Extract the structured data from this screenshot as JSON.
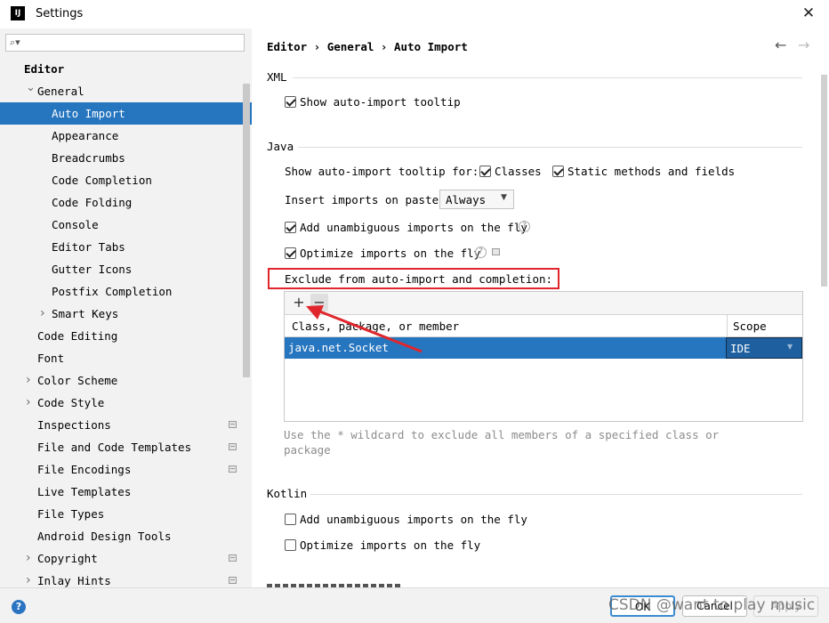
{
  "window": {
    "title": "Settings",
    "logo": "IJ",
    "close_label": "✕"
  },
  "sidebar": {
    "search_icon": "magnifier-icon",
    "items": [
      {
        "label": "Editor",
        "indent": 0,
        "bold": true
      },
      {
        "label": "General",
        "indent": 1,
        "expanded": true
      },
      {
        "label": "Auto Import",
        "indent": 2,
        "selected": true
      },
      {
        "label": "Appearance",
        "indent": 2
      },
      {
        "label": "Breadcrumbs",
        "indent": 2
      },
      {
        "label": "Code Completion",
        "indent": 2
      },
      {
        "label": "Code Folding",
        "indent": 2
      },
      {
        "label": "Console",
        "indent": 2
      },
      {
        "label": "Editor Tabs",
        "indent": 2
      },
      {
        "label": "Gutter Icons",
        "indent": 2
      },
      {
        "label": "Postfix Completion",
        "indent": 2
      },
      {
        "label": "Smart Keys",
        "indent": 2,
        "collapsed": true
      },
      {
        "label": "Code Editing",
        "indent": 1
      },
      {
        "label": "Font",
        "indent": 1
      },
      {
        "label": "Color Scheme",
        "indent": 1,
        "collapsed": true
      },
      {
        "label": "Code Style",
        "indent": 1,
        "collapsed": true
      },
      {
        "label": "Inspections",
        "indent": 1,
        "project": true
      },
      {
        "label": "File and Code Templates",
        "indent": 1,
        "project": true
      },
      {
        "label": "File Encodings",
        "indent": 1,
        "project": true
      },
      {
        "label": "Live Templates",
        "indent": 1
      },
      {
        "label": "File Types",
        "indent": 1
      },
      {
        "label": "Android Design Tools",
        "indent": 1
      },
      {
        "label": "Copyright",
        "indent": 1,
        "collapsed": true,
        "project": true
      },
      {
        "label": "Inlay Hints",
        "indent": 1,
        "collapsed": true,
        "project": true
      }
    ]
  },
  "main": {
    "breadcrumb": "Editor › General › Auto Import",
    "back_icon": "←",
    "forward_icon": "→",
    "xml": {
      "title": "XML",
      "show_tooltip": {
        "label": "Show auto-import tooltip",
        "checked": true
      }
    },
    "java": {
      "title": "Java",
      "tooltip_for_label": "Show auto-import tooltip for:",
      "classes": {
        "label": "Classes",
        "checked": true
      },
      "static_methods": {
        "label": "Static methods and fields",
        "checked": true
      },
      "insert_paste_label": "Insert imports on paste:",
      "insert_paste_value": "Always",
      "unambiguous": {
        "label": "Add unambiguous imports on the fly",
        "checked": true
      },
      "optimize": {
        "label": "Optimize imports on the fly",
        "checked": true
      },
      "exclude_label": "Exclude from auto-import and completion:",
      "table": {
        "add_label": "+",
        "remove_label": "−",
        "col_class": "Class, package, or member",
        "col_scope": "Scope",
        "rows": [
          {
            "name": "java.net.Socket",
            "scope": "IDE"
          }
        ]
      },
      "hint": "Use the * wildcard to exclude all members of a specified class or package"
    },
    "kotlin": {
      "title": "Kotlin",
      "unambiguous": {
        "label": "Add unambiguous imports on the fly",
        "checked": false
      },
      "optimize": {
        "label": "Optimize imports on the fly",
        "checked": false
      }
    }
  },
  "footer": {
    "help_label": "?",
    "ok_label": "OK",
    "cancel_label": "Cancel",
    "apply_label": "Apply"
  },
  "watermark": "CSDN @want to play music",
  "colors": {
    "selection": "#2675bf",
    "highlight_border": "#e0262c",
    "arrow": "#e0262c"
  }
}
